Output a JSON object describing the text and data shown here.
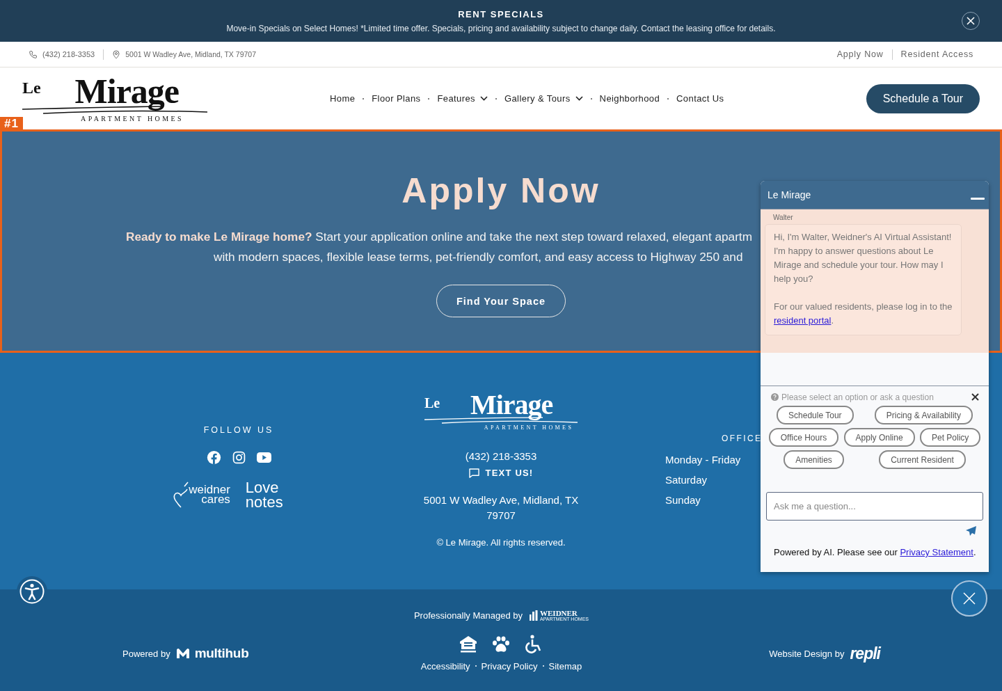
{
  "banner": {
    "title": "RENT SPECIALS",
    "message": "Move-in Specials on Select Homes! *Limited time offer. Specials, pricing and availability subject to change daily. Contact the leasing office for details."
  },
  "utility_bar": {
    "phone": "(432) 218-3353",
    "address": "5001 W Wadley Ave, Midland, TX 79707",
    "links": [
      "Apply Now",
      "Resident Access"
    ]
  },
  "logo": {
    "prefix": "Le",
    "name": "Mirage",
    "tagline": "APARTMENT HOMES"
  },
  "nav": [
    {
      "label": "Home",
      "dropdown": false
    },
    {
      "label": "Floor Plans",
      "dropdown": false
    },
    {
      "label": "Features",
      "dropdown": true
    },
    {
      "label": "Gallery & Tours",
      "dropdown": true
    },
    {
      "label": "Neighborhood",
      "dropdown": false
    },
    {
      "label": "Contact Us",
      "dropdown": false
    }
  ],
  "cta": "Schedule a Tour",
  "highlight": {
    "label": "#1"
  },
  "hero": {
    "title": "Apply Now",
    "lines": [
      "**Ready to make Le Mirage home?** Start your application online and take the next step toward relaxed, elegant apartm",
      "with modern spaces, flexible lease terms, pet-friendly comfort, and easy access to Highway 250 and"
    ],
    "button": "Find Your Space"
  },
  "footer": {
    "follow_heading": "FOLLOW US",
    "partners": [
      {
        "lines": [
          "weidner",
          "cares"
        ]
      },
      {
        "lines": [
          "Love",
          "notes"
        ]
      }
    ],
    "logo": {
      "prefix": "Le",
      "name": "Mirage",
      "tagline": "APARTMENT HOMES"
    },
    "phone": "(432) 218-3353",
    "text_us": "TEXT US!",
    "address": "5001 W Wadley Ave, Midland, TX 79707",
    "copyright": "© Le Mirage. All rights reserved.",
    "office_heading": "OFFICE",
    "days": [
      "Monday - Friday",
      "Saturday",
      "Sunday"
    ]
  },
  "bottom": {
    "managed_by": "Professionally Managed by",
    "manager_logo": {
      "name": "WEIDNER",
      "tagline": "APARTMENT HOMES"
    },
    "powered_by": "Powered by",
    "powered_logo": "multihub",
    "design_by": "Website Design by",
    "design_logo": "repli",
    "links": [
      "Accessibility",
      "Privacy Policy",
      "Sitemap"
    ]
  },
  "chat": {
    "title": "Le Mirage",
    "sender": "Walter",
    "message": "Hi, I'm Walter, Weidner's AI Virtual Assistant! I'm happy to answer questions about Le Mirage and schedule your tour. How may I help you?",
    "resident_note": "For our valued residents, please log in to the",
    "resident_link": "resident portal",
    "resident_after": ".",
    "prompt": "Please select an option or ask a question",
    "options": [
      [
        "Schedule Tour",
        "Pricing & Availability"
      ],
      [
        "Office Hours",
        "Apply Online",
        "Pet Policy"
      ],
      [
        "Amenities",
        "Current Resident"
      ]
    ],
    "input": {
      "placeholder": "Ask me a question..."
    },
    "disclaimer": "Powered by AI. Please see our",
    "disclaimer_link": "Privacy Statement",
    "disclaimer_after": "."
  }
}
